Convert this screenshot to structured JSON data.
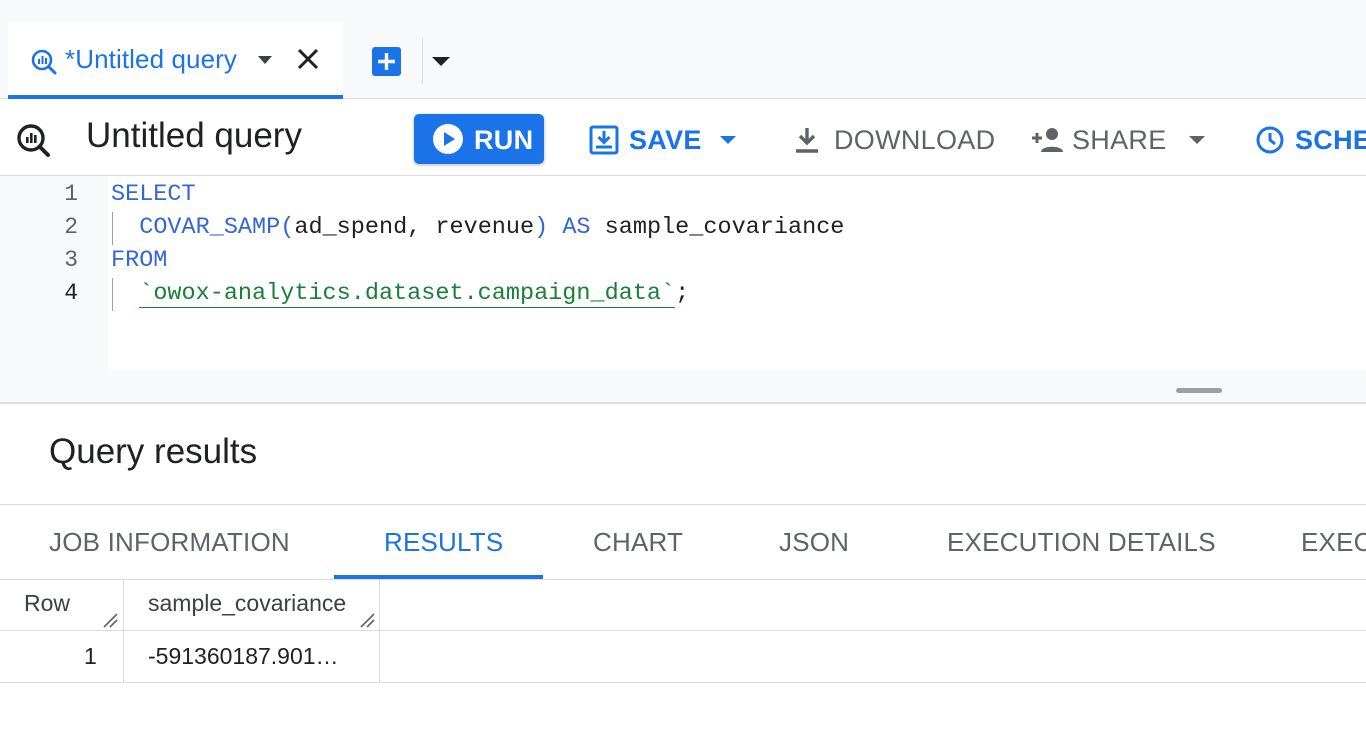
{
  "tab": {
    "label": "*Untitled query"
  },
  "toolbar": {
    "title": "Untitled query",
    "run": "RUN",
    "save": "SAVE",
    "download": "DOWNLOAD",
    "share": "SHARE",
    "schedule": "SCHE"
  },
  "editor": {
    "line_numbers": [
      "1",
      "2",
      "3",
      "4"
    ],
    "line1_kw": "SELECT",
    "line2_fn": "COVAR_SAMP(",
    "line2_args": "ad_spend, revenue",
    "line2_paren": ")",
    "line2_as": "AS",
    "line2_alias": "sample_covariance",
    "line3_kw": "FROM",
    "line4_table": "`owox-analytics.dataset.campaign_data`",
    "line4_end": ";"
  },
  "results": {
    "title": "Query results",
    "tabs": [
      "JOB INFORMATION",
      "RESULTS",
      "CHART",
      "JSON",
      "EXECUTION DETAILS",
      "EXEC"
    ],
    "active_tab": "RESULTS",
    "columns": [
      "Row",
      "sample_covariance"
    ],
    "rows": [
      {
        "row": "1",
        "sample_covariance": "-591360187.901…"
      }
    ]
  },
  "colors": {
    "accent": "#1a73e8",
    "string": "#188038",
    "keyword": "#3367d6"
  }
}
